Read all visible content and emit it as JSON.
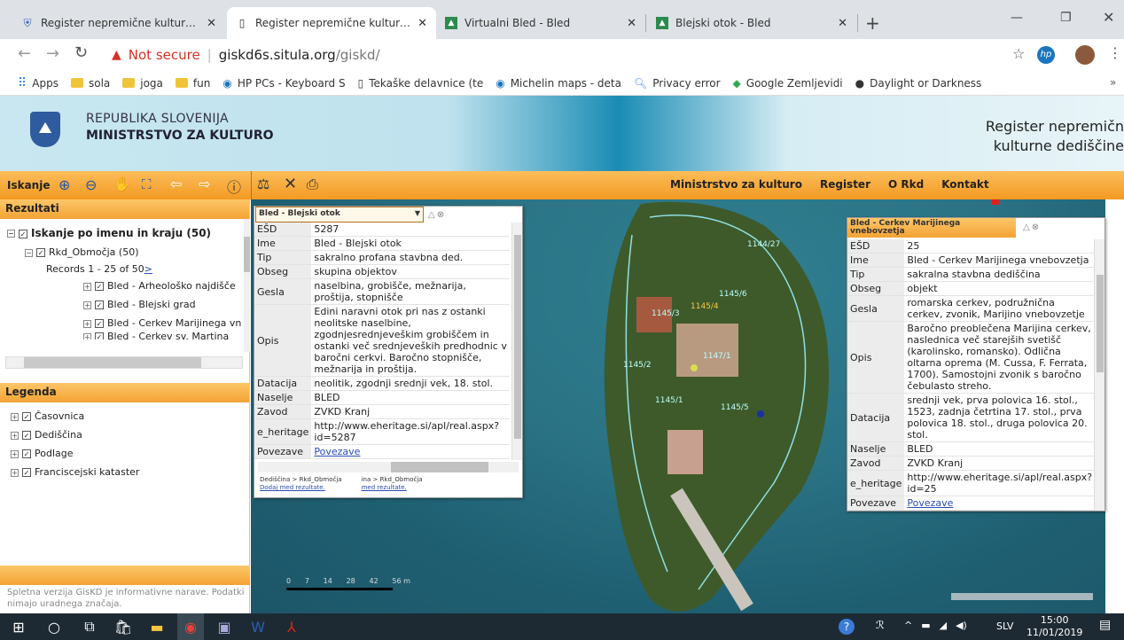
{
  "browser": {
    "tabs": [
      {
        "title": "Register nepremične kulturne de"
      },
      {
        "title": "Register nepremične kulturne de"
      },
      {
        "title": "Virtualni Bled - Bled"
      },
      {
        "title": "Blejski otok - Bled"
      }
    ],
    "security": "Not secure",
    "url_host": "giskd6s.situla.org",
    "url_path": "/giskd/",
    "bookmarks": [
      "Apps",
      "sola",
      "joga",
      "fun",
      "HP PCs - Keyboard S",
      "Tekaške delavnice (te",
      "Michelin maps - deta",
      "Privacy error",
      "Google Zemljevidi",
      "Daylight or Darkness"
    ],
    "more": "»"
  },
  "banner": {
    "line1": "REPUBLIKA SLOVENIJA",
    "line2": "MINISTRSTVO ZA KULTURO",
    "right1": "Register nepremičn",
    "right2": "kulturne dediščine"
  },
  "toolbar": {
    "label": "Iskanje",
    "nav": [
      "Ministrstvo za kulturo",
      "Register",
      "O Rkd",
      "Kontakt"
    ]
  },
  "results": {
    "header": "Rezultati",
    "search_title": "Iskanje po imenu in kraju (50)",
    "group": "Rkd_Območja (50)",
    "records": "Records 1 - 25 of 50",
    "next": ">",
    "items": [
      "Bled - Arheološko najdišče",
      "Bled - Blejski grad",
      "Bled - Cerkev Marijinega vn",
      "Bled - Cerkev sv. Martina"
    ]
  },
  "legend": {
    "header": "Legenda",
    "items": [
      "Časovnica",
      "Dediščina",
      "Podlage",
      "Franciscejski kataster"
    ]
  },
  "footer_note": {
    "line1": "Spletna verzija GisKD je informativne narave. Podatki",
    "line2": "nimajo uradnega značaja."
  },
  "popup1": {
    "title": "Bled - Blejski otok",
    "rows": [
      {
        "k": "EŠD",
        "v": "5287"
      },
      {
        "k": "Ime",
        "v": "Bled - Blejski otok"
      },
      {
        "k": "Tip",
        "v": "sakralno profana stavbna ded."
      },
      {
        "k": "Obseg",
        "v": "skupina objektov"
      },
      {
        "k": "Gesla",
        "v": "naselbina, grobišče, mežnarija, proštija, stopnišče"
      },
      {
        "k": "Opis",
        "v": "Edini naravni otok pri nas z ostanki neolitske naselbine, zgodnjesrednjeveškim grobiščem in ostanki več srednjeveških predhodnic v baročni cerkvi. Baročno stopnišče, mežnarija in proštija."
      },
      {
        "k": "Datacija",
        "v": "neolitik, zgodnji srednji vek, 18. stol."
      },
      {
        "k": "Naselje",
        "v": "BLED"
      },
      {
        "k": "Zavod",
        "v": "ZVKD Kranj"
      },
      {
        "k": "e_heritage",
        "v": "http://www.eheritage.si/apl/real.aspx?id=5287"
      },
      {
        "k": "Povezave",
        "v": "Povezave"
      }
    ],
    "crumb1": "Dediščina > Rkd_Območja",
    "crumb2": "ina > Rkd_Območja",
    "add1": "Dodaj med rezultate.",
    "add2": "med rezultate."
  },
  "popup2": {
    "title": "Bled - Cerkev Marijinega vnebovzetja",
    "rows": [
      {
        "k": "EŠD",
        "v": "25"
      },
      {
        "k": "Ime",
        "v": "Bled - Cerkev Marijinega vnebovzetja"
      },
      {
        "k": "Tip",
        "v": "sakralna stavbna dediščina"
      },
      {
        "k": "Obseg",
        "v": "objekt"
      },
      {
        "k": "Gesla",
        "v": "romarska cerkev, podružnična cerkev, zvonik, Marijino vnebovzetje"
      },
      {
        "k": "Opis",
        "v": "Baročno preoblečena Marijina cerkev, naslednica več starejših svetišč (karolinsko, romansko). Odlična oltarna oprema (M. Cussa, F. Ferrata, 1700). Samostojni zvonik s baročno čebulasto streho."
      },
      {
        "k": "Datacija",
        "v": "srednji vek, prva polovica 16. stol., 1523, zadnja četrtina 17. stol., prva polovica 18. stol., druga polovica 20. stol."
      },
      {
        "k": "Naselje",
        "v": "BLED"
      },
      {
        "k": "Zavod",
        "v": "ZVKD Kranj"
      },
      {
        "k": "e_heritage",
        "v": "http://www.eheritage.si/apl/real.aspx?id=25"
      },
      {
        "k": "Povezave",
        "v": "Povezave"
      }
    ]
  },
  "map_labels": [
    "1144/27",
    "1145/6",
    "1145/3",
    "1145/4",
    "1147/1",
    "1145/2",
    "1145/1",
    "1145/5"
  ],
  "scale": [
    "0",
    "7",
    "14",
    "28",
    "42",
    "56 m"
  ],
  "taskbar": {
    "lang": "SLV",
    "time": "15:00",
    "date": "11/01/2019"
  }
}
